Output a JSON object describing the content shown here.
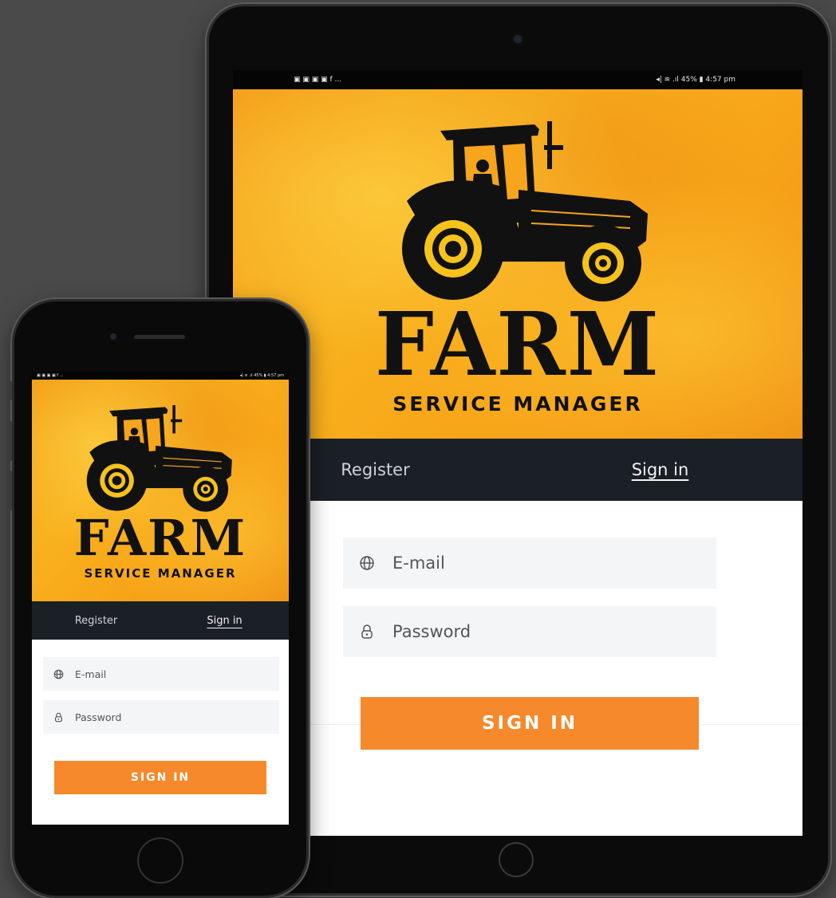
{
  "status_bar": {
    "left_icons": "▣ ▣  ▣ ▣ f ...",
    "right_text": "◂| ≋ .ıl 45% ▮ 4:57 pm"
  },
  "brand": {
    "title": "FARM",
    "subtitle": "SERVICE MANAGER"
  },
  "tabs": {
    "register": "Register",
    "signin": "Sign in"
  },
  "form": {
    "email_placeholder": "E-mail",
    "password_placeholder": "Password",
    "submit_label": "SIGN IN",
    "email_icon": "globe-icon",
    "password_icon": "lock-icon"
  },
  "colors": {
    "accent": "#f5892b",
    "tab_bar": "#1b1f26",
    "hero_orange": "#f7a418",
    "background": "#4a4a4a"
  }
}
